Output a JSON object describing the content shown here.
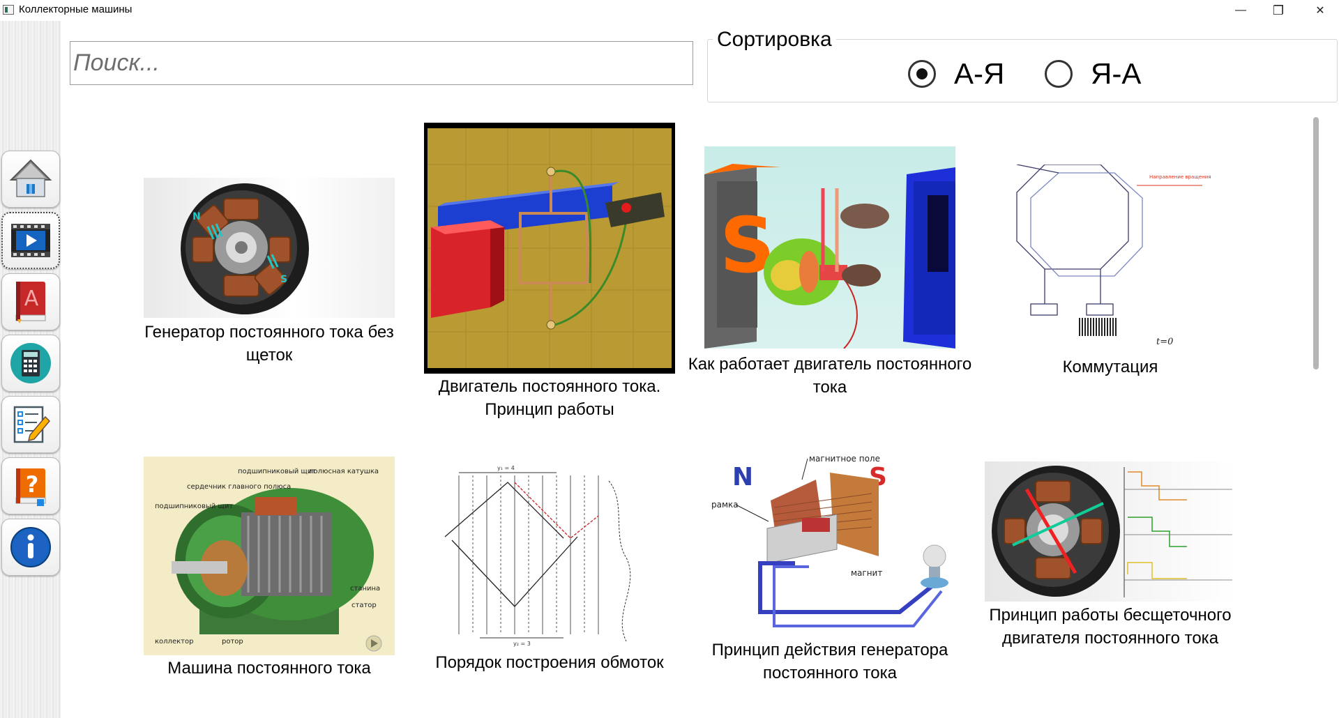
{
  "window": {
    "title": "Коллекторные машины"
  },
  "titlebar": {
    "minimize": "—",
    "maximize": "❐",
    "close": "✕"
  },
  "sidebar": {
    "items": [
      {
        "name": "home",
        "icon": "home-icon"
      },
      {
        "name": "video",
        "icon": "video-player-icon",
        "active": true
      },
      {
        "name": "textbook",
        "icon": "book-icon"
      },
      {
        "name": "calculator",
        "icon": "calculator-icon"
      },
      {
        "name": "tests",
        "icon": "checklist-icon"
      },
      {
        "name": "help",
        "icon": "question-book-icon"
      },
      {
        "name": "info",
        "icon": "info-icon"
      }
    ]
  },
  "search": {
    "placeholder": "Поиск..."
  },
  "sort": {
    "legend": "Сортировка",
    "options": [
      {
        "label": "А-Я",
        "selected": true
      },
      {
        "label": "Я-А",
        "selected": false
      }
    ]
  },
  "videos": [
    {
      "title": "Генератор постоянного тока без щеток"
    },
    {
      "title": "Двигатель постоянного тока. Принцип работы"
    },
    {
      "title": "Как работает двигатель постоянного тока"
    },
    {
      "title": "Коммутация"
    },
    {
      "title": "Машина постоянного тока"
    },
    {
      "title": "Порядок построения обмоток"
    },
    {
      "title": "Принцип действия генератора постоянного тока"
    },
    {
      "title": "Принцип работы бесщеточного двигателя постоянного тока"
    }
  ],
  "thumb_text": {
    "commutation_note": "Направление вращения",
    "t0": "t=0",
    "machine_labels": [
      "подшипниковый щит",
      "полюсная катушка",
      "сердечник главного полюса",
      "подшипниковый щит",
      "станина",
      "статор",
      "коллектор",
      "ротор"
    ],
    "winding_top": "y₁ = 4",
    "winding_bottom": "y₂ = 3",
    "generator_labels": [
      "магнитное поле",
      "рамка",
      "магнит"
    ],
    "pole_n": "N",
    "pole_s": "S"
  }
}
